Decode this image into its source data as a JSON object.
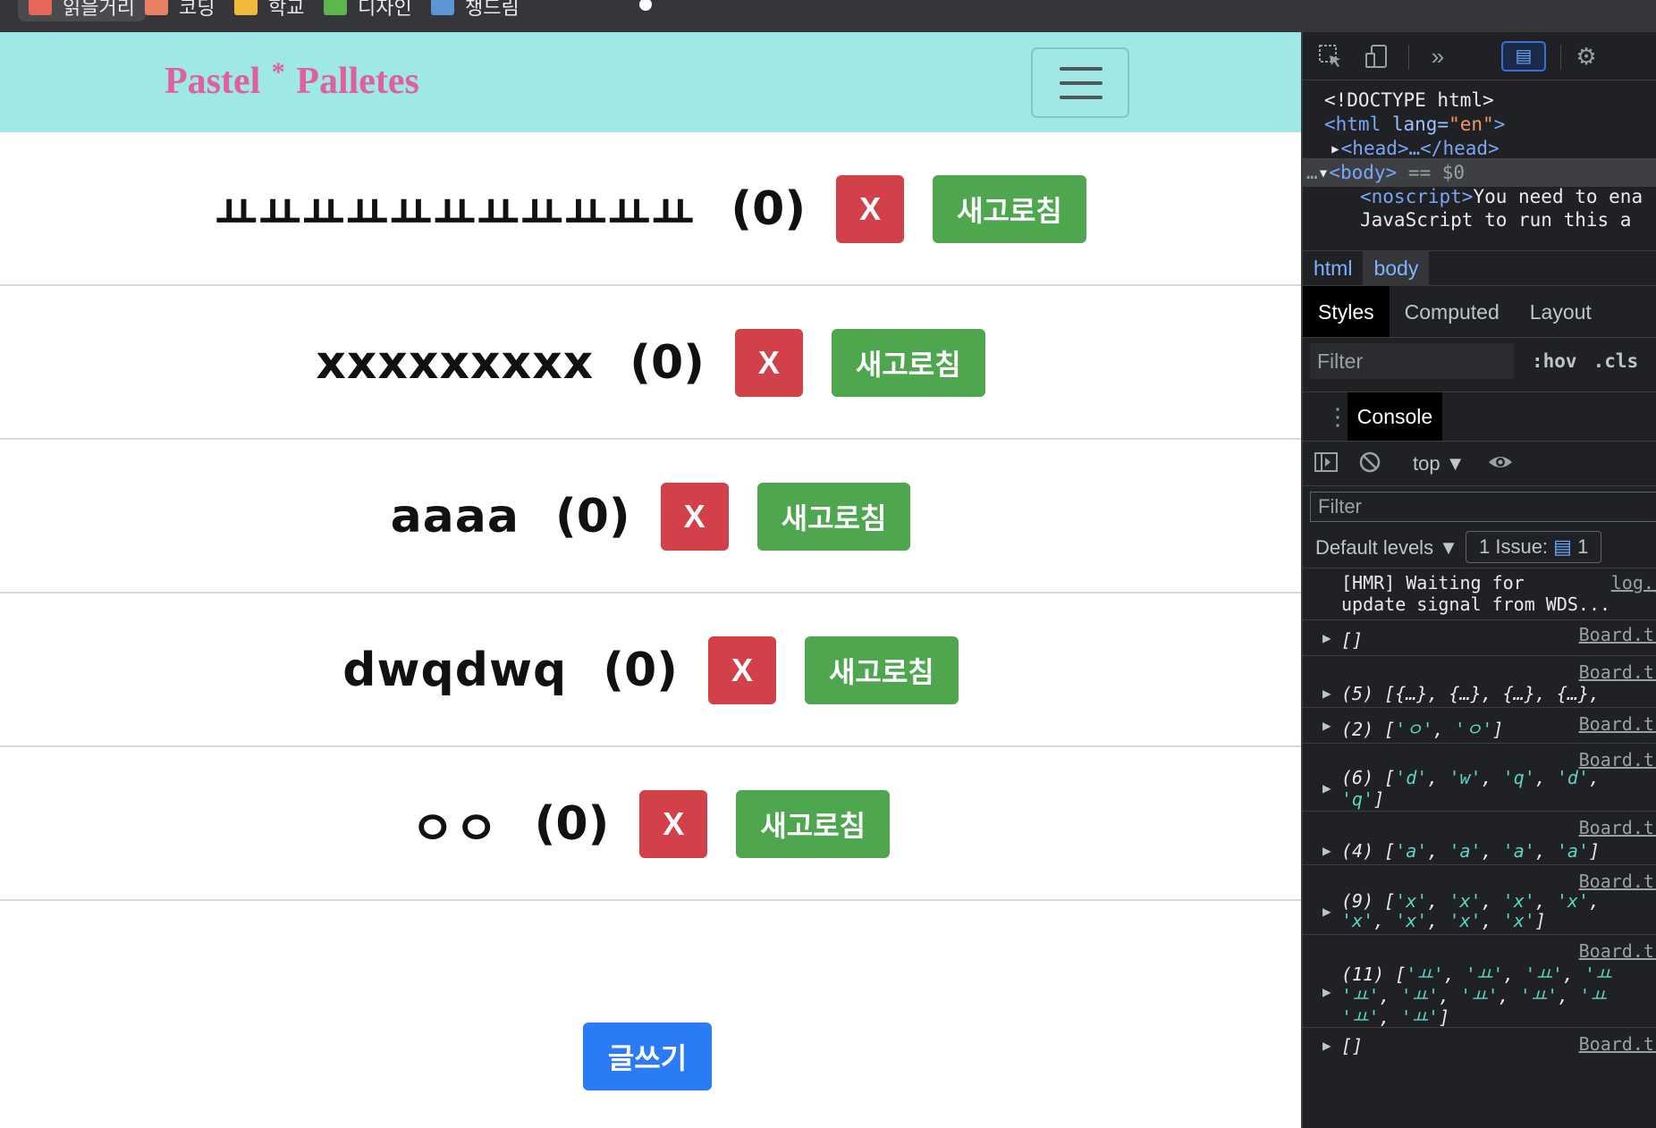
{
  "bookmarks": [
    {
      "label": "읽을거리",
      "color": "#e8655a"
    },
    {
      "label": "코딩",
      "color": "#e98062"
    },
    {
      "label": "학교",
      "color": "#f0b93b"
    },
    {
      "label": "디자인",
      "color": "#5db64b"
    },
    {
      "label": "챙드림",
      "color": "#5b95d6"
    }
  ],
  "navbar": {
    "brand_left": "Pastel",
    "brand_star": "*",
    "brand_right": "Palletes"
  },
  "posts": [
    {
      "title": "ㅛㅛㅛㅛㅛㅛㅛㅛㅛㅛㅛ",
      "count": "(0)",
      "delete": "X",
      "refresh": "새고로침"
    },
    {
      "title": "xxxxxxxxx",
      "count": "(0)",
      "delete": "X",
      "refresh": "새고로침"
    },
    {
      "title": "aaaa",
      "count": "(0)",
      "delete": "X",
      "refresh": "새고로침"
    },
    {
      "title": "dwqdwq",
      "count": "(0)",
      "delete": "X",
      "refresh": "새고로침"
    },
    {
      "title": "ㅇㅇ",
      "count": "(0)",
      "delete": "X",
      "refresh": "새고로침"
    }
  ],
  "write_button": "글쓰기",
  "devtools": {
    "dom": {
      "doctype": "<!DOCTYPE html>",
      "html_open": "<html",
      "html_attr": " lang=",
      "html_val": "\"en\"",
      "html_close": ">",
      "head": "<head>…</head>",
      "body": "<body>",
      "body_eq": " == $0",
      "noscript_tag": "<noscript>",
      "noscript_text": "You need to ena",
      "noscript_text2": "JavaScript to run this a"
    },
    "crumbs": [
      "html",
      "body"
    ],
    "tabs": [
      "Styles",
      "Computed",
      "Layout"
    ],
    "styles_filter": "Filter",
    "hov": ":hov",
    "cls": ".cls",
    "console_tab": "Console",
    "context": "top ▼",
    "console_filter": "Filter",
    "levels": "Default levels ▼",
    "issue_label": "1 Issue:",
    "issue_count": "1",
    "logs": [
      {
        "msg1": "[HMR] Waiting for",
        "msg2": "update signal from WDS...",
        "src": "log.js"
      },
      {
        "msg1": "[]",
        "src": "Board.tsx"
      },
      {
        "msg1": "(5) [{…}, {…}, {…}, {…},",
        "src": "Board.tsx"
      },
      {
        "msg1": "(2) ['ㅇ', 'ㅇ']",
        "src": "Board.tsx"
      },
      {
        "msg1": "(6) ['d', 'w', 'q', 'd',",
        "msg2": "'q']",
        "src": "Board.tsx"
      },
      {
        "msg1": "(4) ['a', 'a', 'a', 'a']",
        "src": "Board.tsx"
      },
      {
        "msg1": "(9) ['x', 'x', 'x', 'x',",
        "msg2": "'x', 'x', 'x', 'x']",
        "src": "Board.tsx"
      },
      {
        "msg1": "(11) ['ㅛ', 'ㅛ', 'ㅛ', 'ㅛ",
        "msg2": "'ㅛ', 'ㅛ', 'ㅛ', 'ㅛ', 'ㅛ",
        "msg3": "'ㅛ', 'ㅛ']",
        "src": "Board.tsx"
      },
      {
        "msg1": "[]",
        "src": "Board.tsx"
      }
    ]
  }
}
